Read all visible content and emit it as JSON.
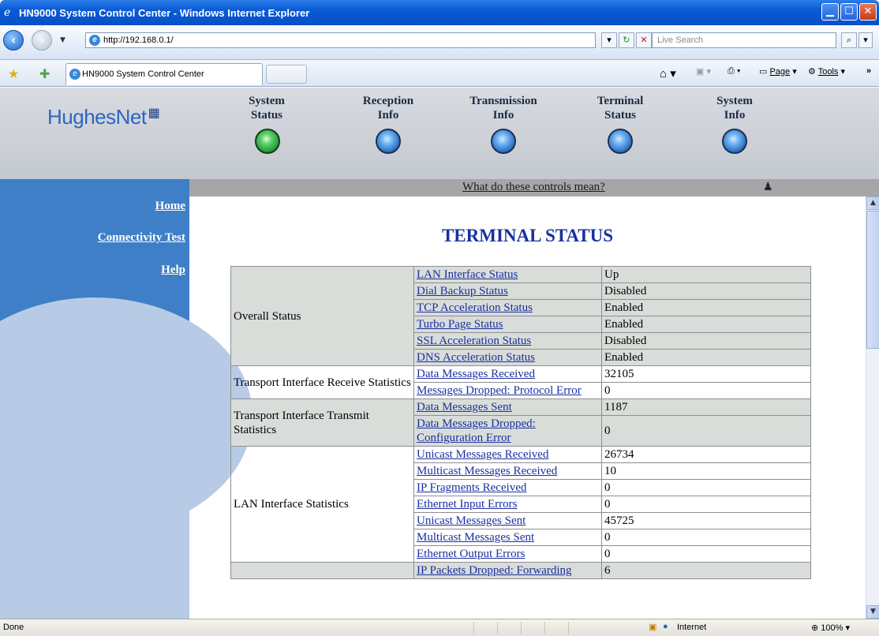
{
  "window": {
    "title": "HN9000 System Control Center - Windows Internet Explorer"
  },
  "address": {
    "url": "http://192.168.0.1/",
    "search_placeholder": "Live Search"
  },
  "tab": {
    "title": "HN9000 System Control Center"
  },
  "command_bar": {
    "page": "Page",
    "tools": "Tools"
  },
  "site": {
    "logo": "HughesNet",
    "nav": [
      {
        "line1": "System",
        "line2": "Status",
        "status_color": "#2aa640"
      },
      {
        "line1": "Reception",
        "line2": "Info",
        "status_color": "#3a86d8"
      },
      {
        "line1": "Transmission",
        "line2": "Info",
        "status_color": "#3a86d8"
      },
      {
        "line1": "Terminal",
        "line2": "Status",
        "status_color": "#3a86d8"
      },
      {
        "line1": "System",
        "line2": "Info",
        "status_color": "#3a86d8"
      }
    ],
    "help_link": "What do these controls mean?",
    "sidebar": {
      "home": "Home",
      "connectivity": "Connectivity Test",
      "help": "Help"
    }
  },
  "main": {
    "heading": "TERMINAL STATUS",
    "groups": {
      "overall": "Overall Status",
      "receive": "Transport Interface Receive Statistics",
      "transmit": "Transport Interface Transmit Statistics",
      "lan": "LAN Interface Statistics"
    },
    "rows": [
      {
        "label": "LAN Interface Status",
        "value": "Up"
      },
      {
        "label": "Dial Backup Status",
        "value": "Disabled"
      },
      {
        "label": "TCP Acceleration Status",
        "value": "Enabled"
      },
      {
        "label": "Turbo Page Status",
        "value": "Enabled"
      },
      {
        "label": "SSL Acceleration Status",
        "value": "Disabled"
      },
      {
        "label": "DNS Acceleration Status",
        "value": "Enabled"
      },
      {
        "label": "Data Messages Received",
        "value": "32105"
      },
      {
        "label": "Messages Dropped: Protocol Error",
        "value": "0"
      },
      {
        "label": "Data Messages Sent",
        "value": "1187"
      },
      {
        "label": "Data Messages Dropped: Configuration Error",
        "value": "0"
      },
      {
        "label": "Unicast Messages Received",
        "value": "26734"
      },
      {
        "label": "Multicast Messages Received",
        "value": "10"
      },
      {
        "label": "IP Fragments Received",
        "value": "0"
      },
      {
        "label": "Ethernet Input Errors",
        "value": "0"
      },
      {
        "label": "Unicast Messages Sent",
        "value": "45725"
      },
      {
        "label": "Multicast Messages Sent",
        "value": "0"
      },
      {
        "label": "Ethernet Output Errors",
        "value": "0"
      },
      {
        "label": "IP Packets Dropped: Forwarding",
        "value": "6"
      }
    ]
  },
  "statusbar": {
    "left": "Done",
    "zone": "Internet",
    "zoom": "100%"
  }
}
